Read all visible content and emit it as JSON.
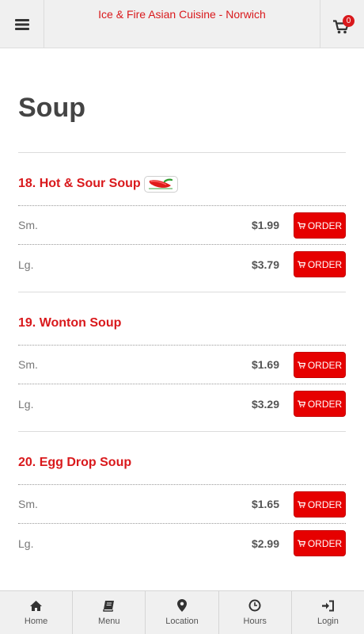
{
  "header": {
    "title": "Ice & Fire Asian Cuisine - Norwich",
    "cart_count": "0",
    "brand_color": "#d9191c"
  },
  "page": {
    "title": "Soup"
  },
  "items": [
    {
      "name": "18. Hot & Sour Soup",
      "spicy_icon": "chili-pepper-icon",
      "sizes": [
        {
          "label": "Sm.",
          "price": "$1.99",
          "button": "ORDER"
        },
        {
          "label": "Lg.",
          "price": "$3.79",
          "button": "ORDER"
        }
      ]
    },
    {
      "name": "19. Wonton Soup",
      "sizes": [
        {
          "label": "Sm.",
          "price": "$1.69",
          "button": "ORDER"
        },
        {
          "label": "Lg.",
          "price": "$3.29",
          "button": "ORDER"
        }
      ]
    },
    {
      "name": "20. Egg Drop Soup",
      "sizes": [
        {
          "label": "Sm.",
          "price": "$1.65",
          "button": "ORDER"
        },
        {
          "label": "Lg.",
          "price": "$2.99",
          "button": "ORDER"
        }
      ]
    }
  ],
  "bottom_nav": [
    {
      "label": "Home",
      "icon": "home-icon"
    },
    {
      "label": "Menu",
      "icon": "book-icon"
    },
    {
      "label": "Location",
      "icon": "map-marker-icon"
    },
    {
      "label": "Hours",
      "icon": "clock-icon"
    },
    {
      "label": "Login",
      "icon": "sign-in-icon"
    }
  ]
}
